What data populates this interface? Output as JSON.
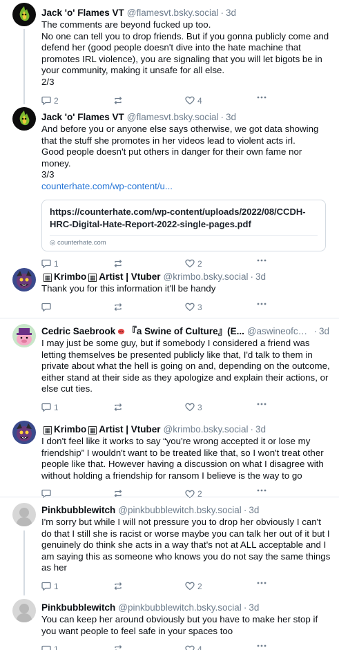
{
  "posts": [
    {
      "author": "Jack 'o' Flames VT",
      "handle": "@flamesvt.bsky.social",
      "time": "3d",
      "lines": [
        "The comments are beyond fucked up too.",
        "No one can tell you to drop friends. But if you gonna publicly come and",
        "defend her (good people doesn't dive into the hate machine that",
        "promotes IRL violence), you are signaling that you will let bigots be in",
        "your community, making it unsafe for all else.",
        "2/3"
      ],
      "replies": "2",
      "reposts": "",
      "likes": "4"
    },
    {
      "author": "Jack 'o' Flames VT",
      "handle": "@flamesvt.bsky.social",
      "time": "3d",
      "lines": [
        "And before you or anyone else says otherwise, we got data showing",
        "that the stuff she promotes in her videos lead to violent acts irl.",
        "Good people doesn't put others in danger for their own fame nor",
        "money.",
        "3/3"
      ],
      "link": "counterhate.com/wp-content/u...",
      "card": {
        "title_1": "https://counterhate.com/wp-content/uploads/2022/08/CCDH-",
        "title_2": "HRC-Digital-Hate-Report-2022-single-pages.pdf",
        "domain": "counterhate.com"
      },
      "replies": "1",
      "reposts": "",
      "likes": "2"
    },
    {
      "author": "Krimbo",
      "author_suffix": "Artist | Vtuber",
      "handle": "@krimbo.bsky.social",
      "time": "3d",
      "lines": [
        "Thank you for this information it'll be handy"
      ],
      "replies": "",
      "reposts": "",
      "likes": "3"
    },
    {
      "author": "Cedric Saebrook",
      "author_suffix": "『a Swine of Culture』(E...",
      "handle": "@aswineofculture...",
      "time": "3d",
      "lines": [
        "I may just be some guy, but if somebody I considered a friend was",
        "letting themselves be presented publicly like that, I'd talk to them in",
        "private about what the hell is going on and, depending on the outcome,",
        "either stand at their side as they apologize and explain their actions, or",
        "else cut ties."
      ],
      "replies": "1",
      "reposts": "",
      "likes": "3"
    },
    {
      "author": "Krimbo",
      "author_suffix": "Artist | Vtuber",
      "handle": "@krimbo.bsky.social",
      "time": "3d",
      "lines": [
        "I don't feel like it works to say “you're wrong accepted it or lose my",
        "friendship” I wouldn't want to be treated like that, so I won't treat other",
        "people like that. However having a discussion on what I disagree with",
        "without holding a friendship for ransom I believe is the way to go"
      ],
      "replies": "",
      "reposts": "",
      "likes": "2"
    },
    {
      "author": "Pinkbubblewitch",
      "handle": "@pinkbubblewitch.bsky.social",
      "time": "3d",
      "lines": [
        "I'm sorry but while I will not pressure you to drop her obviously I can't",
        "do that I still she is racist or worse maybe you can talk her out of it but I",
        "genuinely do think she acts in a way that's not at ALL acceptable and I",
        "am saying this as someone who knows you do not say the same things",
        "as her"
      ],
      "replies": "1",
      "reposts": "",
      "likes": "2"
    },
    {
      "author": "Pinkbubblewitch",
      "handle": "@pinkbubblewitch.bsky.social",
      "time": "3d",
      "lines": [
        "You can keep her around obviously but you have to make her stop if",
        "you want people to feel safe in your spaces too"
      ],
      "replies": "1",
      "reposts": "",
      "likes": "4"
    }
  ],
  "separator": "·"
}
